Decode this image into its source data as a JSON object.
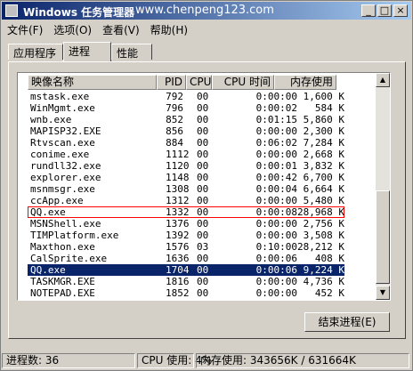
{
  "window": {
    "title": "Windows 任务管理器",
    "watermark": "www.chenpeng123.com"
  },
  "menu": [
    "文件(F)",
    "选项(O)",
    "查看(V)",
    "帮助(H)"
  ],
  "tabs": [
    {
      "label": "应用程序",
      "active": false
    },
    {
      "label": "进程",
      "active": true
    },
    {
      "label": "性能",
      "active": false
    }
  ],
  "columns": [
    "映像名称",
    "PID",
    "CPU",
    "CPU 时间",
    "内存使用"
  ],
  "processes": [
    {
      "name": "mstask.exe",
      "pid": "792",
      "cpu": "00",
      "time": "0:00:00",
      "mem": "1,600 K"
    },
    {
      "name": "WinMgmt.exe",
      "pid": "796",
      "cpu": "00",
      "time": "0:00:02",
      "mem": "584 K"
    },
    {
      "name": "wnb.exe",
      "pid": "852",
      "cpu": "00",
      "time": "0:01:15",
      "mem": "5,860 K"
    },
    {
      "name": "MAPISP32.EXE",
      "pid": "856",
      "cpu": "00",
      "time": "0:00:00",
      "mem": "2,300 K"
    },
    {
      "name": "Rtvscan.exe",
      "pid": "884",
      "cpu": "00",
      "time": "0:06:02",
      "mem": "7,284 K"
    },
    {
      "name": "conime.exe",
      "pid": "1112",
      "cpu": "00",
      "time": "0:00:00",
      "mem": "2,668 K"
    },
    {
      "name": "rundll32.exe",
      "pid": "1120",
      "cpu": "00",
      "time": "0:00:01",
      "mem": "3,832 K"
    },
    {
      "name": "explorer.exe",
      "pid": "1148",
      "cpu": "00",
      "time": "0:00:42",
      "mem": "6,700 K"
    },
    {
      "name": "msnmsgr.exe",
      "pid": "1308",
      "cpu": "00",
      "time": "0:00:04",
      "mem": "6,664 K"
    },
    {
      "name": "ccApp.exe",
      "pid": "1312",
      "cpu": "00",
      "time": "0:00:00",
      "mem": "5,480 K"
    },
    {
      "name": "QQ.exe",
      "pid": "1332",
      "cpu": "00",
      "time": "0:00:08",
      "mem": "28,968 K",
      "boxed": true
    },
    {
      "name": "MSNShell.exe",
      "pid": "1376",
      "cpu": "00",
      "time": "0:00:00",
      "mem": "2,756 K"
    },
    {
      "name": "TIMPlatform.exe",
      "pid": "1392",
      "cpu": "00",
      "time": "0:00:00",
      "mem": "3,508 K"
    },
    {
      "name": "Maxthon.exe",
      "pid": "1576",
      "cpu": "03",
      "time": "0:10:00",
      "mem": "28,212 K"
    },
    {
      "name": "CalSprite.exe",
      "pid": "1636",
      "cpu": "00",
      "time": "0:00:06",
      "mem": "408 K"
    },
    {
      "name": "QQ.exe",
      "pid": "1704",
      "cpu": "00",
      "time": "0:00:06",
      "mem": "9,224 K",
      "selected": true
    },
    {
      "name": "TASKMGR.EXE",
      "pid": "1816",
      "cpu": "00",
      "time": "0:00:00",
      "mem": "4,736 K"
    },
    {
      "name": "NOTEPAD.EXE",
      "pid": "1852",
      "cpu": "00",
      "time": "0:00:00",
      "mem": "452 K"
    }
  ],
  "end_button": "结束进程(E)",
  "status": {
    "processes": "进程数: 36",
    "cpu": "CPU 使用: 4%",
    "memory": "内存使用: 343656K / 631664K"
  },
  "colors": {
    "selection": "#0a246a",
    "highlight_box": "#ff0000"
  }
}
